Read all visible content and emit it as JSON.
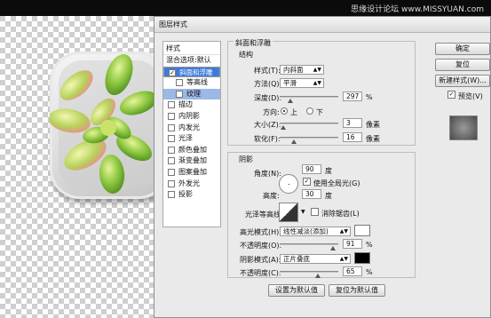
{
  "watermark": "思缘设计论坛 www.MISSYUAN.com",
  "dialog": {
    "title": "图层样式",
    "styles": {
      "header": "样式",
      "blend_options": "混合选项:默认",
      "items": [
        {
          "label": "斜面和浮雕",
          "checked": true,
          "selected": true
        },
        {
          "label": "等高线",
          "checked": false,
          "sub": true
        },
        {
          "label": "纹理",
          "checked": false,
          "sub": true,
          "subsel": true
        },
        {
          "label": "描边",
          "checked": false
        },
        {
          "label": "内阴影",
          "checked": false
        },
        {
          "label": "内发光",
          "checked": false
        },
        {
          "label": "光泽",
          "checked": false
        },
        {
          "label": "颜色叠加",
          "checked": false
        },
        {
          "label": "渐变叠加",
          "checked": false
        },
        {
          "label": "图案叠加",
          "checked": false
        },
        {
          "label": "外发光",
          "checked": false
        },
        {
          "label": "投影",
          "checked": false
        }
      ]
    },
    "bevel": {
      "section_title": "斜面和浮雕",
      "structure_title": "结构",
      "style_label": "样式(T):",
      "style_value": "内斜面",
      "technique_label": "方法(Q):",
      "technique_value": "平滑",
      "depth_label": "深度(D):",
      "depth_value": "297",
      "depth_unit": "%",
      "direction_label": "方向:",
      "direction_up": "上",
      "direction_down": "下",
      "size_label": "大小(Z):",
      "size_value": "3",
      "size_unit": "像素",
      "soften_label": "软化(F):",
      "soften_value": "16",
      "soften_unit": "像素"
    },
    "shading": {
      "title": "阴影",
      "angle_label": "角度(N):",
      "angle_value": "90",
      "angle_unit": "度",
      "global_light_label": "使用全局光(G)",
      "altitude_label": "高度:",
      "altitude_value": "30",
      "altitude_unit": "度",
      "gloss_contour_label": "光泽等高线:",
      "anti_alias_label": "消除锯齿(L)",
      "highlight_mode_label": "高光模式(H):",
      "highlight_mode_value": "线性减淡(添加)",
      "highlight_opacity_label": "不透明度(O):",
      "highlight_opacity_value": "91",
      "highlight_opacity_unit": "%",
      "shadow_mode_label": "阴影模式(A):",
      "shadow_mode_value": "正片叠底",
      "shadow_opacity_label": "不透明度(C):",
      "shadow_opacity_value": "65",
      "shadow_opacity_unit": "%",
      "highlight_color": "#ffffff",
      "shadow_color": "#000000"
    },
    "buttons": {
      "ok": "确定",
      "reset": "复位",
      "new_style": "新建样式(W)...",
      "preview": "预览(V)",
      "set_default": "设置为默认值",
      "reset_default": "复位为默认值"
    }
  }
}
